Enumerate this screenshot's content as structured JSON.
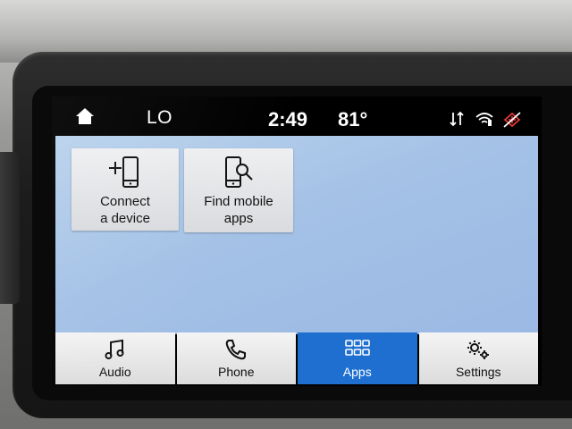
{
  "status_bar": {
    "home_icon": "home-icon",
    "climate_setting": "LO",
    "time": "2:49",
    "temperature": "81°",
    "icons": [
      "data-transfer-icon",
      "wifi-icon",
      "connectivity-off-icon"
    ]
  },
  "apps": [
    {
      "label": "Connect\na device",
      "icon": "phone-add-icon"
    },
    {
      "label": "Find mobile\napps",
      "icon": "phone-search-icon"
    }
  ],
  "bottom_nav": [
    {
      "label": "Audio",
      "icon": "music-note-icon",
      "active": false
    },
    {
      "label": "Phone",
      "icon": "phone-handset-icon",
      "active": false
    },
    {
      "label": "Apps",
      "icon": "apps-grid-icon",
      "active": true
    },
    {
      "label": "Settings",
      "icon": "gears-icon",
      "active": false
    }
  ],
  "colors": {
    "accent": "#1e6fd0",
    "background": "#a8c4e8",
    "status_alert": "#e03a3a"
  }
}
